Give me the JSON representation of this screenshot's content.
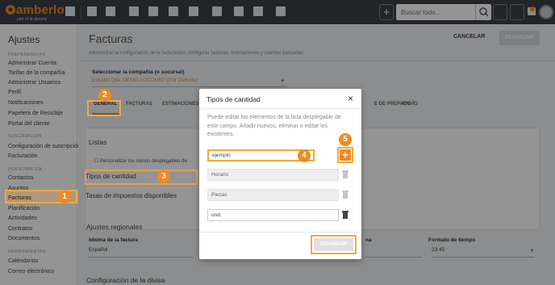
{
  "app": {
    "logo_text": "amberlo",
    "logo_sub": "part of ⊕ dpsone",
    "search_placeholder": "Buscar todo...",
    "add_label": "+",
    "colors": {
      "accent": "#f08a24",
      "topbar": "#3b3f45",
      "highlight": "#f2a93b"
    }
  },
  "sidebar": {
    "title": "Ajustes",
    "sections": [
      {
        "label": "PREFERENCIAS",
        "items": [
          "Administrar Cuenta",
          "Tarifas de la compañía",
          "Administrar Usuarios",
          "Perfil",
          "Notificaciones",
          "Papelera de Reciclaje",
          "Portal del cliente"
        ]
      },
      {
        "label": "SUSCRIPCIÓN",
        "items": [
          "Configuración de suscripción",
          "Facturación"
        ]
      },
      {
        "label": "PERSONALIZA",
        "items": [
          "Contactos",
          "Asuntos",
          "Facturas",
          "Planificación",
          "Actividades",
          "Contratos",
          "Documentos"
        ]
      },
      {
        "label": "HERRAMIENTAS",
        "items": [
          "Calendarios",
          "Correo electrónico"
        ]
      }
    ],
    "active_item": "Facturas"
  },
  "main": {
    "title": "Facturas",
    "subtitle": "Administrar la configuración de la facturación, configurar facturas, estimaciones y cuentas bancarias",
    "cancel_label": "CANCELAR",
    "save_label": "GUARDAR",
    "company_label": "Seleccionar la compañía (o sucursal)",
    "company_value": "Estudio Q&L DEMO ACCOUNT (Por Defecto)",
    "tabs": [
      "GENERAL",
      "FACTURAS",
      "ESTIMACIONES",
      "E DE PREPAGO",
      "ENVÍO"
    ],
    "lists_title": "Listas",
    "customize_text": "Personalizar los menús desplegables de",
    "list_items": [
      "Tipos de cantidad",
      "Tasas de impuestos disponibles"
    ],
    "regional_title": "Ajustes regionales",
    "invoice_language_label": "Idioma de la factura",
    "invoice_language_value": "Español",
    "hora_label": "na",
    "time_format_label": "Formato de tiempo",
    "time_format_value": "23:45",
    "currency_title": "Configuración de la divisa"
  },
  "modal": {
    "title": "Tipos de cantidad",
    "close": "×",
    "description": "Puede editar los elementos de la lista desplegable de este campo. Añadir nuevos, eliminar o editar los existentes.",
    "new_value": "ejemplo",
    "add_label": "+",
    "items": [
      "Horario",
      "Piezas",
      "und."
    ],
    "save_label": "GUARDAR"
  },
  "callouts": [
    "1",
    "2",
    "3",
    "4",
    "5"
  ]
}
